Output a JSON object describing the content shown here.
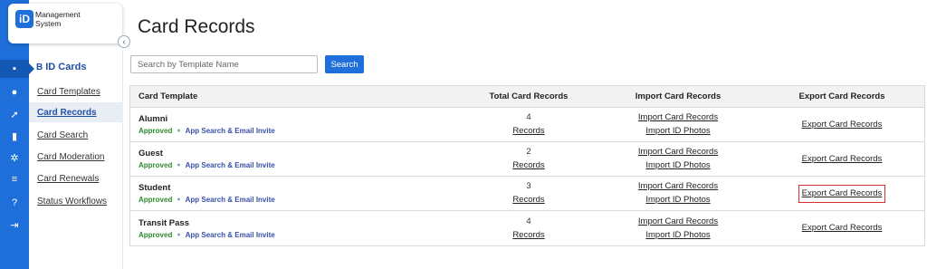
{
  "logo": {
    "mark": "iD",
    "line1": "Management",
    "line2": "System"
  },
  "rail": {
    "items": [
      {
        "icon": "id-card-icon",
        "glyph": "▪"
      },
      {
        "icon": "chat-icon",
        "glyph": "●"
      },
      {
        "icon": "rocket-icon",
        "glyph": "➚"
      },
      {
        "icon": "document-icon",
        "glyph": "▮"
      },
      {
        "icon": "gear-icon",
        "glyph": "✲"
      },
      {
        "icon": "list-icon",
        "glyph": "≡"
      },
      {
        "icon": "help-icon",
        "glyph": "?"
      },
      {
        "icon": "logout-icon",
        "glyph": "⇥"
      }
    ]
  },
  "subnav": {
    "heading_icon": "B",
    "heading": "ID Cards",
    "items": [
      {
        "label": "Card Templates"
      },
      {
        "label": "Card Records"
      },
      {
        "label": "Card Search"
      },
      {
        "label": "Card Moderation"
      },
      {
        "label": "Card Renewals"
      },
      {
        "label": "Status Workflows"
      }
    ]
  },
  "main": {
    "title": "Card Records",
    "search": {
      "placeholder": "Search by Template Name",
      "button": "Search"
    }
  },
  "table": {
    "headers": [
      "Card Template",
      "Total Card Records",
      "Import Card Records",
      "Export Card Records"
    ],
    "rows": [
      {
        "name": "Alumni",
        "status": "Approved",
        "tag": "App Search & Email Invite",
        "count": "4",
        "records_link": "Records",
        "import_link": "Import Card Records",
        "photos_link": "Import ID Photos",
        "export_link": "Export Card Records"
      },
      {
        "name": "Guest",
        "status": "Approved",
        "tag": "App Search & Email Invite",
        "count": "2",
        "records_link": "Records",
        "import_link": "Import Card Records",
        "photos_link": "Import ID Photos",
        "export_link": "Export Card Records"
      },
      {
        "name": "Student",
        "status": "Approved",
        "tag": "App Search & Email Invite",
        "count": "3",
        "records_link": "Records",
        "import_link": "Import Card Records",
        "photos_link": "Import ID Photos",
        "export_link": "Export Card Records"
      },
      {
        "name": "Transit Pass",
        "status": "Approved",
        "tag": "App Search & Email Invite",
        "count": "4",
        "records_link": "Records",
        "import_link": "Import Card Records",
        "photos_link": "Import ID Photos",
        "export_link": "Export Card Records"
      }
    ]
  },
  "colors": {
    "brand": "#1e6fd9",
    "approved": "#2e8b2e",
    "highlight": "#d62f2f"
  }
}
